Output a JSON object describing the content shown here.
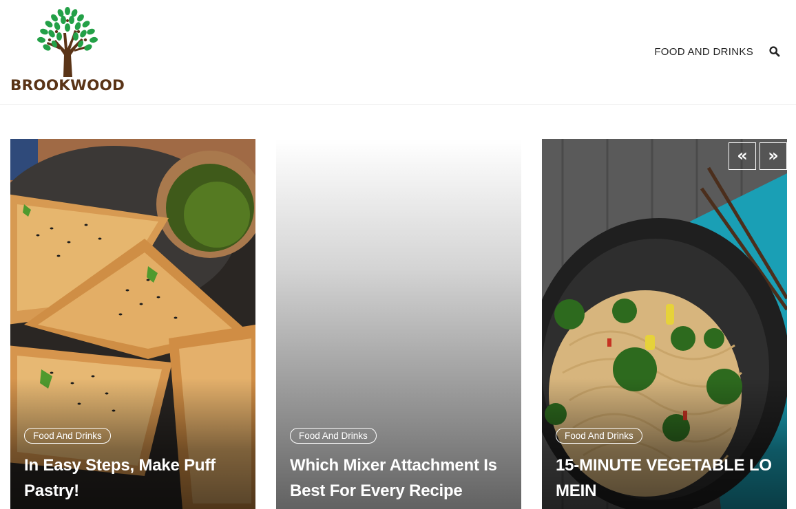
{
  "site": {
    "logo_text": "BROOKWOOD"
  },
  "nav": {
    "items": [
      {
        "label": "Food and Drinks"
      }
    ]
  },
  "colors": {
    "brand_brown": "#5a3417",
    "leaf_green": "#23a047",
    "text": "#222222"
  },
  "slider": {
    "prev_label": "«",
    "next_label": "»",
    "cards": [
      {
        "category": "Food And Drinks",
        "title": "In Easy Steps, Make Puff Pastry!"
      },
      {
        "category": "Food And Drinks",
        "title": "Which Mixer Attachment Is Best For Every Recipe"
      },
      {
        "category": "Food And Drinks",
        "title": "15-MINUTE VEGETABLE LO MEIN"
      }
    ]
  }
}
